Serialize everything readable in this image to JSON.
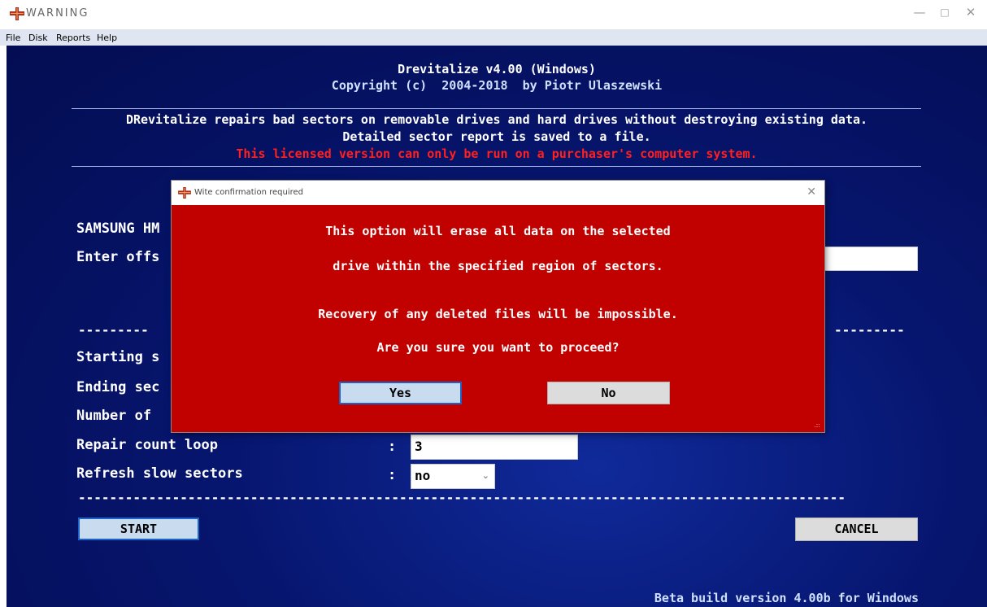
{
  "window": {
    "title": "WARNING"
  },
  "menu": [
    "File",
    "Disk",
    "Reports",
    "Help"
  ],
  "header": {
    "app": "Drevitalize v4.00 (Windows)",
    "copyright": "Copyright (c)  2004-2018  by Piotr Ulaszewski"
  },
  "description": {
    "line1": "DRevitalize repairs bad sectors on removable drives and hard drives without destroying existing data.",
    "line2": "Detailed sector report is saved to a file.",
    "warning": "This licensed version can only be run on a purchaser's computer system."
  },
  "fields": {
    "drive_label": "SAMSUNG HM",
    "offset_label": "Enter offs",
    "dashes_left": "---------",
    "dashes_right": "---------",
    "starting_label": "Starting s",
    "ending_label": "Ending sec",
    "number_label": "Number of",
    "repair_label": "Repair count loop",
    "repair_colon": ":",
    "repair_value": "3",
    "refresh_label": "Refresh slow sectors",
    "refresh_colon": ":",
    "refresh_value": "no",
    "separator": "--------------------------------------------------------------------------------------------------"
  },
  "buttons": {
    "start": "START",
    "cancel": "CANCEL"
  },
  "footer": "Beta build version 4.00b for Windows",
  "dialog": {
    "title": "Wite confirmation required",
    "line1": "This option will erase all data on the selected",
    "line2": "drive within the specified region of sectors.",
    "line3": "Recovery of any deleted files will be impossible.",
    "line4": "Are you sure you want to proceed?",
    "yes": "Yes",
    "no": "No"
  },
  "colors": {
    "background": "#06156e",
    "dialog": "#c10000",
    "warning_text": "#ff2020",
    "focus_border": "#1b63c6"
  }
}
